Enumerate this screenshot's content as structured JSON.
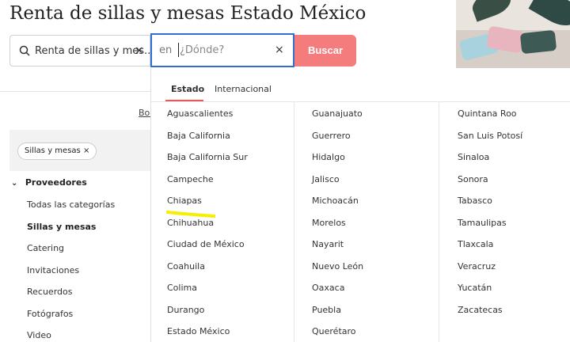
{
  "page": {
    "title": "Renta de sillas y mesas Estado México"
  },
  "search": {
    "query": "Renta de sillas y mes...",
    "clear_icon": "×"
  },
  "location": {
    "prefix": "en",
    "placeholder": "¿Dónde?",
    "clear_icon": "×"
  },
  "buttons": {
    "search_label": "Buscar"
  },
  "sidebar": {
    "link": "Bor",
    "chip_label": "Sillas y mesas",
    "chip_close": "×",
    "section_chevron": "⌄",
    "section_title": "Proveedores",
    "items": [
      "Todas las categorías",
      "Sillas y mesas",
      "Catering",
      "Invitaciones",
      "Recuerdos",
      "Fotógrafos",
      "Video"
    ],
    "active_item": "Sillas y mesas"
  },
  "dropdown": {
    "tabs": [
      "Estado",
      "Internacional"
    ],
    "active_tab": "Estado",
    "columns": [
      [
        "Aguascalientes",
        "Baja California",
        "Baja California Sur",
        "Campeche",
        "Chiapas",
        "Chihuahua",
        "Ciudad de México",
        "Coahuila",
        "Colima",
        "Durango",
        "Estado México"
      ],
      [
        "Guanajuato",
        "Guerrero",
        "Hidalgo",
        "Jalisco",
        "Michoacán",
        "Morelos",
        "Nayarit",
        "Nuevo León",
        "Oaxaca",
        "Puebla",
        "Querétaro"
      ],
      [
        "Quintana Roo",
        "San Luis Potosí",
        "Sinaloa",
        "Sonora",
        "Tabasco",
        "Tamaulipas",
        "Tlaxcala",
        "Veracruz",
        "Yucatán",
        "Zacatecas"
      ]
    ]
  },
  "colors": {
    "accent": "#f47c7c",
    "focus_border": "#2f6fd1",
    "tab_underline": "#e85a5a",
    "highlight": "#f5f000"
  }
}
